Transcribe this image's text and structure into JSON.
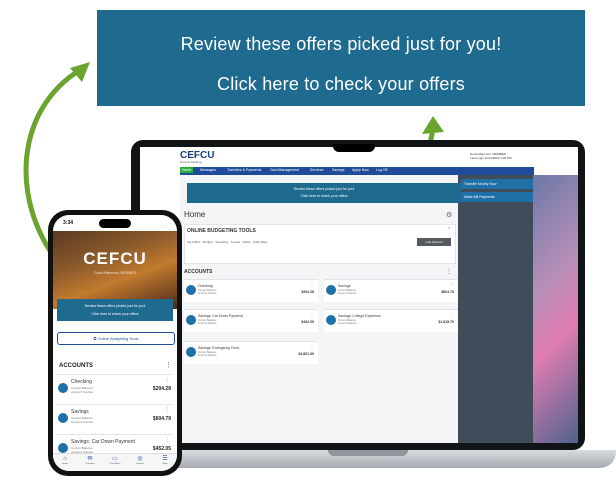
{
  "banner": {
    "line1": "Review these offers picked just for you!",
    "line2": "Click here to check your offers"
  },
  "colors": {
    "offer_blue": "#1f6a8f",
    "nav_blue": "#1e4c9a",
    "arrow_green": "#6aa42f"
  },
  "desktop": {
    "logo": "CEFCU",
    "logo_sub": "Not just banking",
    "topright": [
      "Good Afternoon, MEMBER",
      "Last Login 11/14/2023 1:05 PM"
    ],
    "nav": [
      "Home",
      "Messages",
      "Transfers & Payments",
      "Card Management",
      "Services",
      "Savings",
      "Apply Now",
      "Log Off"
    ],
    "offer": {
      "line1": "Review these offers picked just for you!",
      "line2": "Click here to check your offers"
    },
    "sidebar": [
      "Transfer Money Now",
      "Make Bill Payments"
    ],
    "home_title": "Home",
    "gear_icon": "⚙",
    "budget": {
      "title": "ONLINE BUDGETING TOOLS",
      "links": "Set Filters · Budget · Spending · Trends · Debts · Cash Flow",
      "button": "Link Account"
    },
    "accounts_title": "ACCOUNTS",
    "accounts": [
      {
        "name": "Checking",
        "sub1": "Current Balance",
        "sub2": "Account Number",
        "value": "$204.28"
      },
      {
        "name": "Savings",
        "sub1": "Current Balance",
        "sub2": "Account Number",
        "value": "$604.79"
      },
      {
        "name": "Savings: Car Down Payment",
        "sub1": "Current Balance",
        "sub2": "Account Number",
        "value": "$452.05"
      },
      {
        "name": "Savings: College Expenses",
        "sub1": "Current Balance",
        "sub2": "Account Number",
        "value": "$1,815.70"
      },
      {
        "name": "Savings: Emergency Fund",
        "sub1": "Current Balance",
        "sub2": "Account Number",
        "value": "$4,801.39"
      }
    ]
  },
  "phone": {
    "time": "3:34",
    "logo": "CEFCU",
    "welcome": "Good Afternoon, MEMBER",
    "offer": {
      "line1": "Review these offers picked just for you!",
      "line2": "Click here to check your offers"
    },
    "budget_button": "Online Budgeting Tools",
    "accounts_title": "ACCOUNTS",
    "accounts": [
      {
        "name": "Checking",
        "sub1": "Current Balance",
        "sub2": "Account Number",
        "value": "$204.28"
      },
      {
        "name": "Savings",
        "sub1": "Current Balance",
        "sub2": "Account Number",
        "value": "$604.79"
      },
      {
        "name": "Savings: Car Down Payment",
        "sub1": "Current Balance",
        "sub2": "Account Number",
        "value": "$452.05"
      }
    ],
    "tabs": [
      {
        "icon": "⌂",
        "label": "Home"
      },
      {
        "icon": "✉",
        "label": "Transfers"
      },
      {
        "icon": "▭",
        "label": "Card Mgmt"
      },
      {
        "icon": "◎",
        "label": "Deposit"
      },
      {
        "icon": "☰",
        "label": "More"
      }
    ]
  }
}
